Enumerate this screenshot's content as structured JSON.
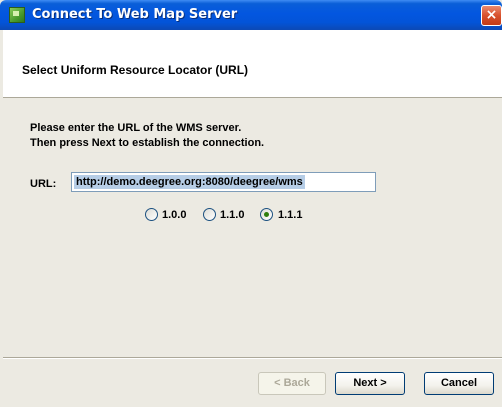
{
  "window": {
    "title": "Connect To Web Map Server",
    "close_glyph": "×"
  },
  "header": {
    "title": "Select Uniform Resource Locator (URL)"
  },
  "content": {
    "instruction_line1": "Please enter the URL of the WMS server.",
    "instruction_line2": "Then press Next to establish the connection.",
    "url_label": "URL:",
    "url_value": "http://demo.deegree.org:8080/deegree/wms",
    "versions": [
      {
        "label": "1.0.0",
        "selected": false
      },
      {
        "label": "1.1.0",
        "selected": false
      },
      {
        "label": "1.1.1",
        "selected": true
      }
    ]
  },
  "buttons": {
    "back_label": "< Back",
    "next_label": "Next >",
    "cancel_label": "Cancel"
  },
  "icons": {
    "app": "map-server-icon",
    "close": "close-icon"
  },
  "colors": {
    "titlebar": "#0356e0",
    "close_button": "#d8512d",
    "dialog_bg": "#eceae2",
    "selection": "#b6cde6",
    "radio_selected": "#2e7d0c"
  }
}
